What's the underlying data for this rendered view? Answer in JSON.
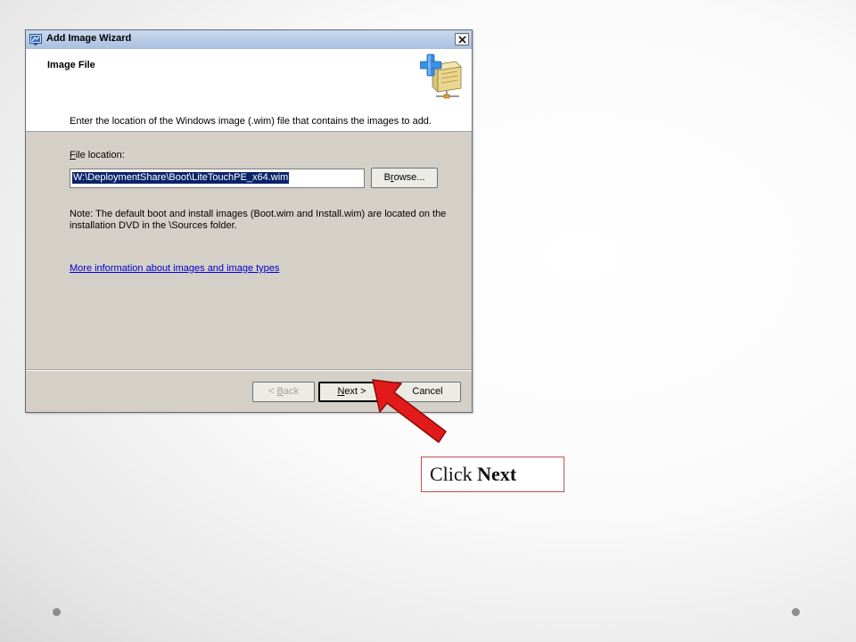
{
  "window": {
    "title": "Add Image Wizard"
  },
  "header": {
    "title": "Image File"
  },
  "content": {
    "instruction": "Enter the location of the Windows image (.wim) file that contains the images to add.",
    "file_label_mnemonic": "F",
    "file_label_rest": "ile location:",
    "file_location_value": "W:\\DeploymentShare\\Boot\\LiteTouchPE_x64.wim",
    "browse_mnemonic": "r",
    "browse_prefix": "B",
    "browse_suffix": "owse...",
    "note": "Note: The default boot and install images (Boot.wim and Install.wim) are located on the installation DVD in the \\Sources folder.",
    "more_info_link": "More information about images and image types"
  },
  "footer": {
    "back_prefix": "< ",
    "back_mnemonic": "B",
    "back_suffix": "ack",
    "next_mnemonic": "N",
    "next_suffix": "ext >",
    "cancel_label": "Cancel"
  },
  "callout": {
    "prefix": "Click ",
    "emphasis": "Next"
  },
  "colors": {
    "accent_arrow": "#e21a1a",
    "selection": "#0a246a",
    "link": "#0000cc"
  },
  "icons": {
    "title": "wizard-app-icon",
    "header": "add-image-box-icon",
    "close": "close-icon",
    "callout": "red-arrow-icon"
  }
}
